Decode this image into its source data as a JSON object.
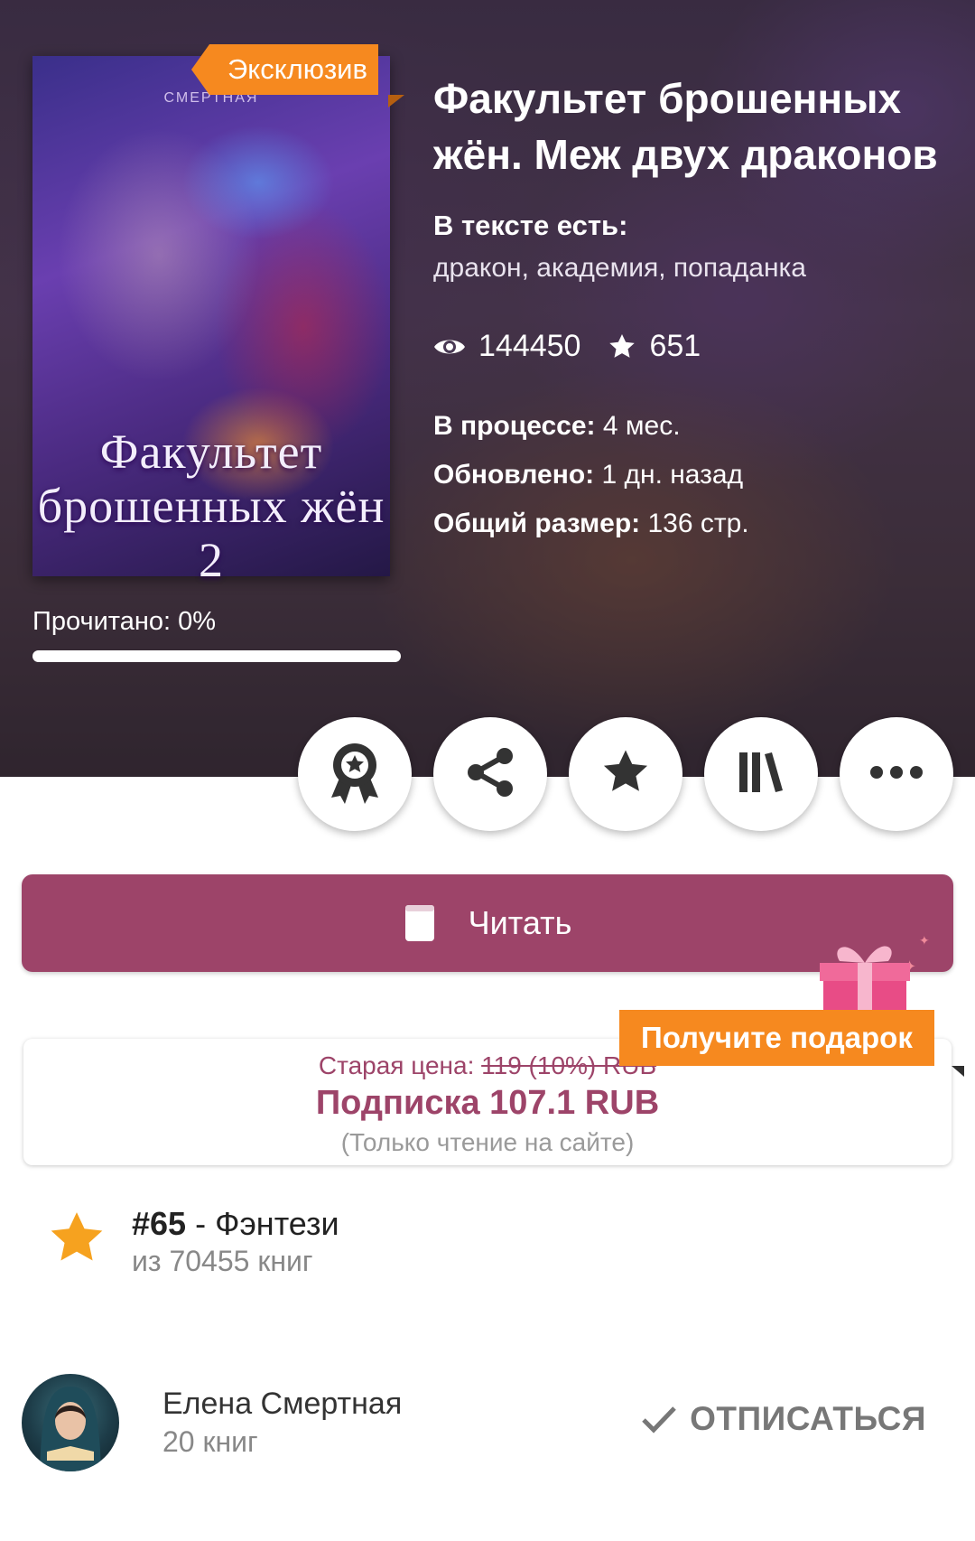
{
  "book": {
    "title": "Факультет брошенных жён. Меж двух драконов",
    "exclusive_badge": "Эксклюзив",
    "cover_title": "Факультет брошенных жён 2",
    "cover_author": "СМЕРТНАЯ",
    "tags_label": "В тексте есть:",
    "tags": "дракон, академия, попаданка",
    "views": "144450",
    "stars": "651",
    "status_label": "В процессе:",
    "status_value": " 4 мес.",
    "updated_label": "Обновлено:",
    "updated_value": " 1 дн. назад",
    "size_label": "Общий размер:",
    "size_value": " 136 стр.",
    "read_progress_text": "Прочитано: 0%",
    "read_progress_value": 0
  },
  "actions": [
    {
      "name": "award-icon"
    },
    {
      "name": "share-icon"
    },
    {
      "name": "star-icon"
    },
    {
      "name": "library-icon"
    },
    {
      "name": "more-icon"
    }
  ],
  "read_button": {
    "label": "Читать"
  },
  "gift": {
    "label": "Получите подарок"
  },
  "price": {
    "old_label": "Старая цена: ",
    "old_value": "119 (10%) RUB",
    "subscription": "Подписка 107.1 RUB",
    "note": "(Только чтение на сайте)"
  },
  "rating": {
    "rank": "#65",
    "genre": " - Фэнтези",
    "of_total": "из 70455 книг"
  },
  "author": {
    "name": "Елена Смертная",
    "books": "20 книг",
    "unsubscribe_label": "ОТПИСАТЬСЯ"
  },
  "colors": {
    "accent": "#9d4469",
    "badge": "#f6891f",
    "star": "#f6a21f"
  }
}
